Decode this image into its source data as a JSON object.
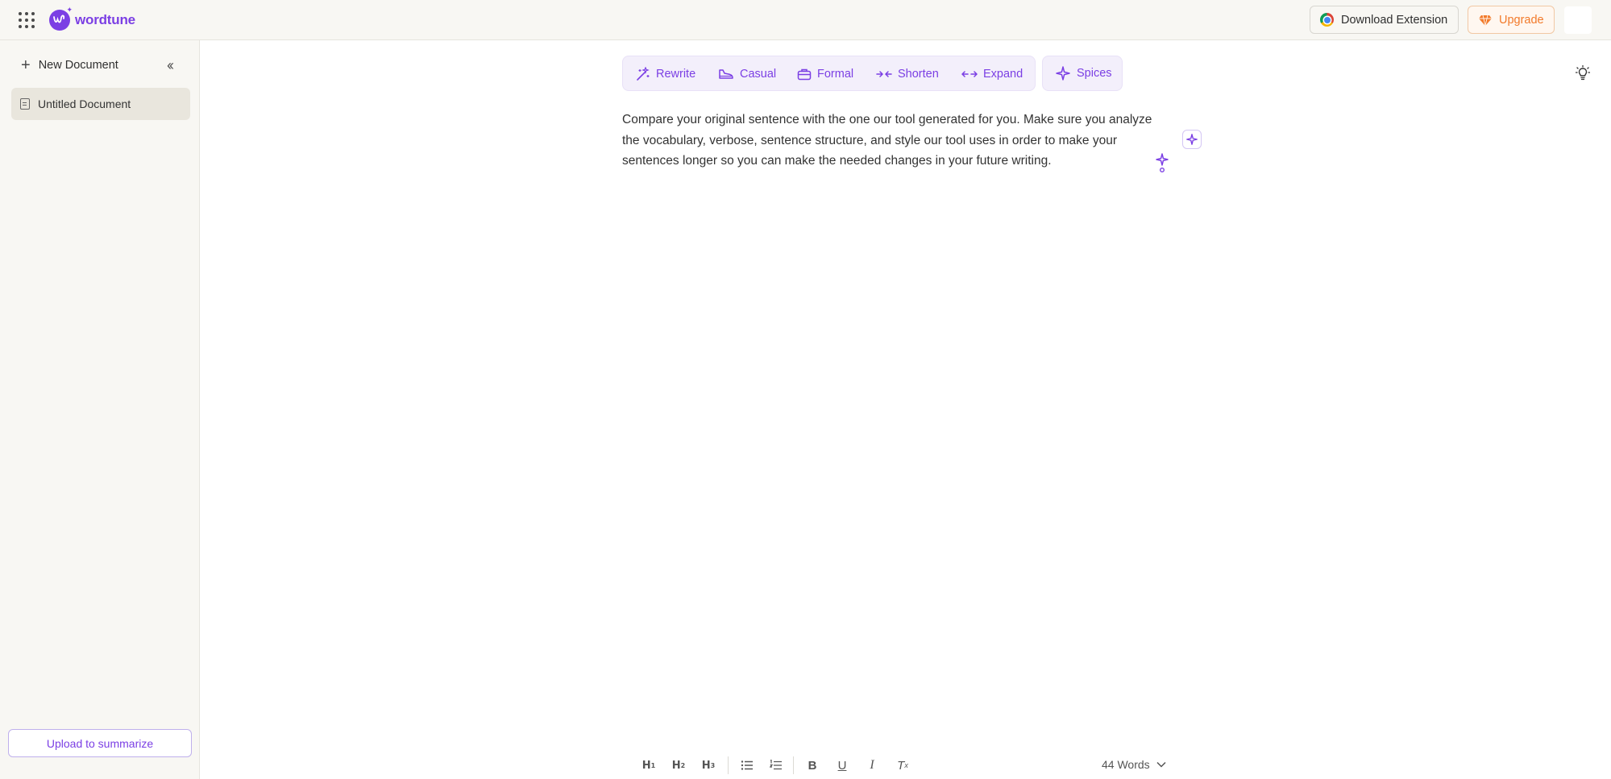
{
  "header": {
    "logo_text": "wordtune",
    "download_label": "Download Extension",
    "upgrade_label": "Upgrade"
  },
  "sidebar": {
    "new_document_label": "New Document",
    "documents": [
      {
        "title": "Untitled Document"
      }
    ],
    "upload_label": "Upload to summarize"
  },
  "toolbar": {
    "tools": [
      {
        "label": "Rewrite",
        "icon": "magic-wand-icon"
      },
      {
        "label": "Casual",
        "icon": "sneaker-icon"
      },
      {
        "label": "Formal",
        "icon": "briefcase-icon"
      },
      {
        "label": "Shorten",
        "icon": "arrows-in-icon"
      },
      {
        "label": "Expand",
        "icon": "arrows-out-icon"
      }
    ],
    "spices_label": "Spices"
  },
  "editor": {
    "text": "Compare your original sentence with the one our tool generated for you. Make sure you analyze the vocabulary, verbose, sentence structure, and style our tool uses in order to make your sentences longer so you can make the needed changes in your future writing."
  },
  "bottom_bar": {
    "word_count": "44 Words"
  },
  "colors": {
    "accent": "#7b3fe4",
    "upgrade": "#f27a2a",
    "sidebar_bg": "#f8f7f3"
  }
}
